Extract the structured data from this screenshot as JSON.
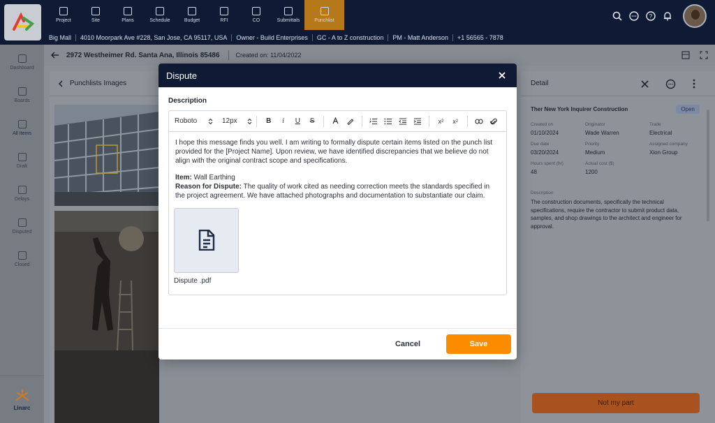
{
  "app": {
    "brand": "Linarc"
  },
  "nav": [
    {
      "label": "Project",
      "icon": "folder-icon"
    },
    {
      "label": "Site",
      "icon": "site-icon"
    },
    {
      "label": "Plans",
      "icon": "plans-icon"
    },
    {
      "label": "Schedule",
      "icon": "calendar-icon"
    },
    {
      "label": "Budget",
      "icon": "budget-icon"
    },
    {
      "label": "RFI",
      "icon": "rfi-icon"
    },
    {
      "label": "CO",
      "icon": "co-icon"
    },
    {
      "label": "Submittals",
      "icon": "submittals-icon"
    },
    {
      "label": "Punchlist",
      "icon": "punchlist-icon",
      "active": true
    }
  ],
  "infobar": [
    "Big Mall",
    "4010 Moorpark Ave #228, San Jose, CA 95117, USA",
    "Owner - Build Enterprises",
    "GC - A to Z construction",
    "PM -  Matt Anderson",
    "+1 56565 - 7878"
  ],
  "sidebar": [
    {
      "label": "Dashboard"
    },
    {
      "label": "Boards"
    },
    {
      "label": "All Items",
      "active": true
    },
    {
      "label": "Draft"
    },
    {
      "label": "Delays"
    },
    {
      "label": "Disputed"
    },
    {
      "label": "Closed"
    }
  ],
  "subheader": {
    "address": "2972 Westheimer Rd. Santa Ana, Illinois 85486",
    "created": "Created on: 11/04/2022"
  },
  "images_panel": {
    "title": "Punchlists Images"
  },
  "detail": {
    "title": "Detail",
    "company": "Ther New York Inquirer Construction",
    "status": "Open",
    "fields": [
      {
        "label": "Created on",
        "value": "01/10/2024"
      },
      {
        "label": "Originator",
        "value": "Wade Warren"
      },
      {
        "label": "Trade",
        "value": "Electrical"
      },
      {
        "label": "Due date",
        "value": "03/20/2024"
      },
      {
        "label": "Priority",
        "value": "Medium"
      },
      {
        "label": "Assigned company",
        "value": "Xion Group"
      },
      {
        "label": "Hours spent (hr)",
        "value": "48"
      },
      {
        "label": "Actual cost ($)",
        "value": "1200"
      }
    ],
    "description_label": "Description",
    "description": "The construction documents, specifically the technical specifications, require the contractor to submit product data, samples, and shop drawings to the architect and engineer for approval.",
    "action": "Not my part"
  },
  "modal": {
    "title": "Dispute",
    "description_label": "Description",
    "toolbar": {
      "font": "Roboto",
      "size": "12px"
    },
    "body": {
      "para1": "I hope this message finds you well. I am writing to formally dispute certain items listed on the punch list provided for the [Project Name]. Upon review, we have identified discrepancies that we believe do not align with the original contract scope and specifications.",
      "item_label": "Item:",
      "item_value": " Wall Earthing",
      "reason_label": "Reason for Dispute:",
      "reason_value": " The quality of work cited as needing correction meets the standards specified in the project agreement. We have attached photographs and documentation to substantiate our claim."
    },
    "attachment": {
      "name": "Dispute .pdf"
    },
    "cancel": "Cancel",
    "save": "Save"
  }
}
